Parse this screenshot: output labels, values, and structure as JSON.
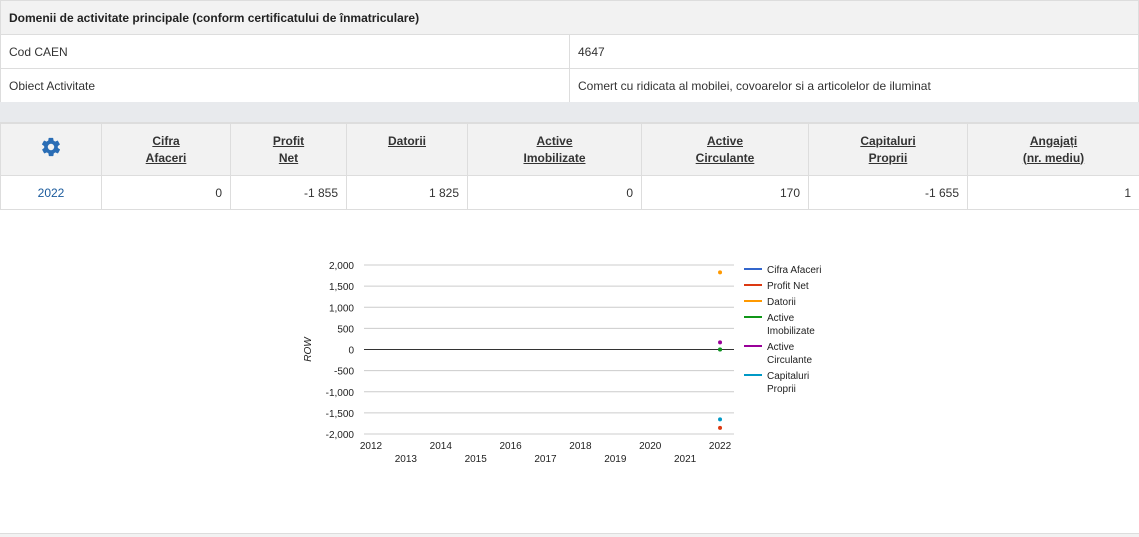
{
  "info": {
    "header": "Domenii de activitate principale (conform certificatului de înmatriculare)",
    "rows": [
      {
        "label": "Cod CAEN",
        "value": "4647"
      },
      {
        "label": "Obiect Activitate",
        "value": "Comert cu ridicata al mobilei, covoarelor si a articolelor de iluminat"
      }
    ]
  },
  "financial": {
    "icon": "gear-icon",
    "columns": [
      {
        "l1": "Cifra",
        "l2": "Afaceri"
      },
      {
        "l1": "Profit",
        "l2": "Net"
      },
      {
        "l1": "Datorii",
        "l2": ""
      },
      {
        "l1": "Active",
        "l2": "Imobilizate"
      },
      {
        "l1": "Active",
        "l2": "Circulante"
      },
      {
        "l1": "Capitaluri",
        "l2": "Proprii"
      },
      {
        "l1": "Angajați",
        "l2": "(nr. mediu)"
      }
    ],
    "rows": [
      {
        "year": "2022",
        "values": [
          "0",
          "-1 855",
          "1 825",
          "0",
          "170",
          "-1 655",
          "1"
        ]
      }
    ]
  },
  "chart_data": {
    "type": "scatter",
    "ylabel": "ROW",
    "xlabel": "",
    "title": "",
    "ylim": [
      -2000,
      2000
    ],
    "yticks": [
      2000,
      1500,
      1000,
      500,
      0,
      -500,
      -1000,
      -1500,
      -2000
    ],
    "ytick_labels": [
      "2,000",
      "1,500",
      "1,000",
      "500",
      "0",
      "-500",
      "-1,000",
      "-1,500",
      "-2,000"
    ],
    "xlim": [
      2011.8,
      2022.4
    ],
    "xticks": [
      2012,
      2013,
      2014,
      2015,
      2016,
      2017,
      2018,
      2019,
      2020,
      2021,
      2022
    ],
    "grid": true,
    "legend_position": "right",
    "series": [
      {
        "name": "Cifra Afaceri",
        "lines": [
          "Cifra Afaceri"
        ],
        "color": "#3366cc",
        "x": [
          2022
        ],
        "y": [
          0
        ]
      },
      {
        "name": "Profit Net",
        "lines": [
          "Profit Net"
        ],
        "color": "#dc3912",
        "x": [
          2022
        ],
        "y": [
          -1855
        ]
      },
      {
        "name": "Datorii",
        "lines": [
          "Datorii"
        ],
        "color": "#ff9900",
        "x": [
          2022
        ],
        "y": [
          1825
        ]
      },
      {
        "name": "Active Imobilizate",
        "lines": [
          "Active",
          "Imobilizate"
        ],
        "color": "#109618",
        "x": [
          2022
        ],
        "y": [
          0
        ]
      },
      {
        "name": "Active Circulante",
        "lines": [
          "Active",
          "Circulante"
        ],
        "color": "#990099",
        "x": [
          2022
        ],
        "y": [
          170
        ]
      },
      {
        "name": "Capitaluri Proprii",
        "lines": [
          "Capitaluri",
          "Proprii"
        ],
        "color": "#0099c6",
        "x": [
          2022
        ],
        "y": [
          -1655
        ]
      }
    ]
  }
}
